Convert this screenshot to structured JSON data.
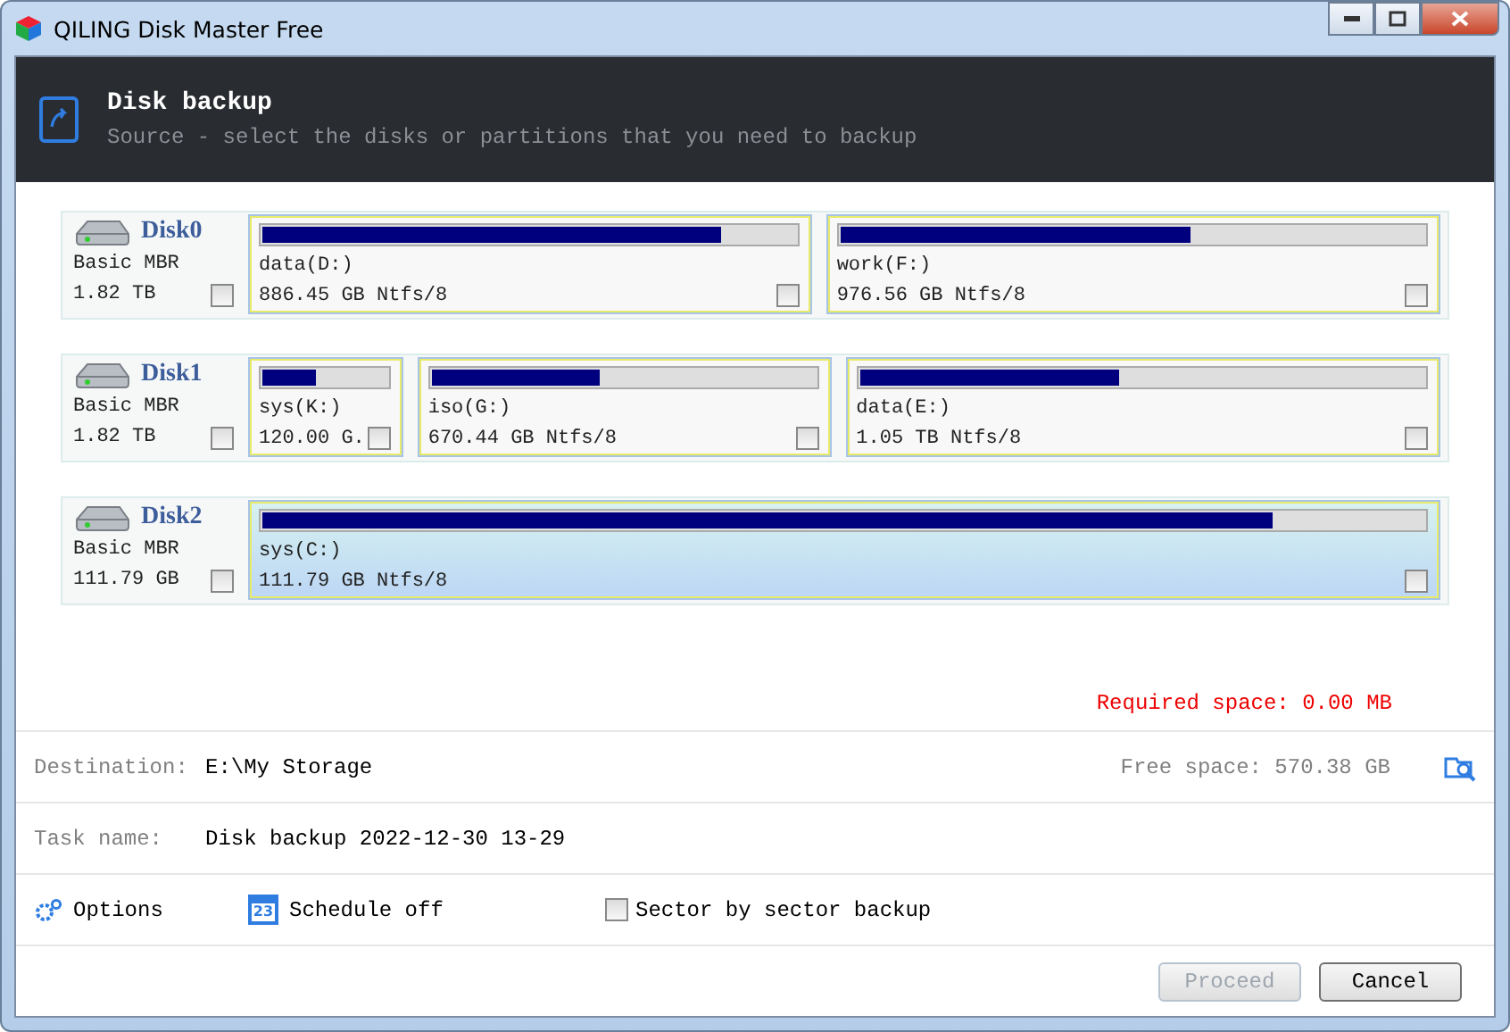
{
  "window": {
    "title": "QILING Disk Master Free"
  },
  "header": {
    "title": "Disk backup",
    "subtitle": "Source - select the disks or partitions that you need to backup"
  },
  "disks": [
    {
      "name": "Disk0",
      "type": "Basic MBR",
      "size": "1.82 TB",
      "checked": false,
      "partitions": [
        {
          "label": "data(D:)",
          "info": "886.45 GB Ntfs/8",
          "level": 0.86,
          "checked": false,
          "selected": false
        },
        {
          "label": "work(F:)",
          "info": "976.56 GB Ntfs/8",
          "level": 0.6,
          "checked": false,
          "selected": false
        }
      ]
    },
    {
      "name": "Disk1",
      "type": "Basic MBR",
      "size": "1.82 TB",
      "checked": false,
      "partitions": [
        {
          "label": "sys(K:)",
          "info": "120.00 G.",
          "level": 0.43,
          "checked": false,
          "selected": false
        },
        {
          "label": "iso(G:)",
          "info": "670.44 GB Ntfs/8",
          "level": 0.44,
          "checked": false,
          "selected": false
        },
        {
          "label": "data(E:)",
          "info": "1.05 TB Ntfs/8",
          "level": 0.46,
          "checked": false,
          "selected": false
        }
      ]
    },
    {
      "name": "Disk2",
      "type": "Basic MBR",
      "size": "111.79 GB",
      "checked": false,
      "partitions": [
        {
          "label": "sys(C:)",
          "info": "111.79 GB Ntfs/8",
          "level": 0.87,
          "checked": false,
          "selected": true
        }
      ]
    }
  ],
  "required_space": "Required space: 0.00 MB",
  "destination": {
    "label": "Destination:",
    "value": "E:\\My Storage",
    "free_space": "Free space: 570.38 GB"
  },
  "task": {
    "label": "Task name:",
    "value": "Disk backup 2022-12-30 13-29"
  },
  "options": {
    "options": "Options",
    "schedule": "Schedule off",
    "schedule_day": "23",
    "sector": {
      "label": "Sector by sector backup",
      "checked": false
    }
  },
  "buttons": [
    {
      "label": "Proceed",
      "disabled": true
    },
    {
      "label": "Cancel",
      "disabled": false
    }
  ]
}
